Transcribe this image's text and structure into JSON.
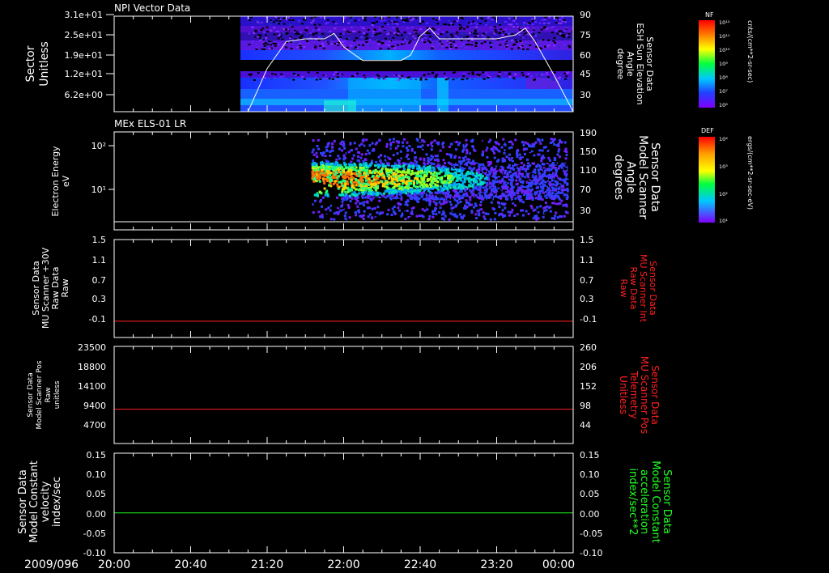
{
  "colors": {
    "background": "#000000",
    "axis": "#ffffff",
    "red": "#ff2020",
    "green": "#20ff20"
  },
  "x_axis": {
    "date_label": "2009/096",
    "tick_labels": [
      "20:00",
      "20:40",
      "21:20",
      "22:00",
      "22:40",
      "23:20",
      "00:00"
    ],
    "start": "20:00",
    "end": "00:00"
  },
  "panels": [
    {
      "id": "sector",
      "title": "NPI Vector Data",
      "left_label": [
        "Sector",
        "Unitless"
      ],
      "left_ticks": [
        "3.1e+01",
        "2.5e+01",
        "1.9e+01",
        "1.2e+01",
        "6.2e+00"
      ],
      "right_label": [
        "Sensor Data",
        "ESH Sun Elevation",
        "Angle",
        "degree"
      ],
      "right_ticks": [
        "90",
        "75",
        "60",
        "45",
        "30"
      ],
      "colorbar": {
        "title": "NF",
        "unit": "cnts/(cm**2-sr-sec)",
        "tick_labels": [
          "10¹²",
          "10¹¹",
          "10¹⁰",
          "10⁹",
          "10⁸",
          "10⁷",
          "10⁶"
        ]
      }
    },
    {
      "id": "els",
      "title": "MEx ELS-01 LR",
      "left_label": [
        "Electron Energy",
        "eV"
      ],
      "left_ticks": [
        "10²",
        "10¹"
      ],
      "right_label": [
        "Sensor Data",
        "Model Scanner",
        "Angle",
        "degrees"
      ],
      "right_ticks": [
        "190",
        "150",
        "110",
        "70",
        "30"
      ],
      "colorbar": {
        "title": "DEF",
        "unit": "ergs/(cm**2-sr-sec-eV)",
        "tick_labels": [
          "10⁴",
          "10³",
          "10²",
          "10¹"
        ]
      }
    },
    {
      "id": "mu30",
      "left_label": [
        "Sensor Data",
        "MU Scanner +30V",
        "Raw Data",
        "Raw"
      ],
      "left_ticks": [
        "1.5",
        "1.1",
        "0.7",
        "0.3",
        "-0.1"
      ],
      "right_label": [
        "Sensor Data",
        "MU Scanner Int",
        "Raw Data",
        "Raw"
      ],
      "right_ticks": [
        "1.5",
        "1.1",
        "0.7",
        "0.3",
        "-0.1"
      ]
    },
    {
      "id": "scanpos",
      "left_label": [
        "Sensor Data",
        "Model Scanner Pos",
        "Raw",
        "unitless"
      ],
      "left_ticks": [
        "23500",
        "18800",
        "14100",
        "9400",
        "4700"
      ],
      "right_label": [
        "Sensor Data",
        "MU Scanner Pos",
        "Telemetry",
        "Unitless"
      ],
      "right_ticks": [
        "260",
        "206",
        "152",
        "98",
        "44"
      ]
    },
    {
      "id": "constvel",
      "left_label": [
        "Sensor Data",
        "Model Constant",
        "velocity",
        "index/sec"
      ],
      "left_ticks": [
        "0.15",
        "0.10",
        "0.05",
        "0.00",
        "-0.05",
        "-0.10"
      ],
      "right_label": [
        "Sensor Data",
        "Model Constant",
        "acceleration",
        "index/sec**2"
      ],
      "right_ticks": [
        "0.15",
        "0.10",
        "0.05",
        "0.00",
        "-0.05",
        "-0.10"
      ]
    }
  ],
  "chart_data": [
    {
      "type": "heatmap",
      "title": "NPI Vector Data",
      "ylabel": "Sector Unitless",
      "y_ticks": [
        "3.1e+01",
        "2.5e+01",
        "1.9e+01",
        "1.2e+01",
        "6.2e+00"
      ],
      "data_start": "21:10",
      "overlay_series": {
        "name": "Sensor Data ESH Sun Elevation Angle",
        "unit": "degree",
        "y_range": [
          18,
          90
        ],
        "x": [
          "20:00",
          "20:30",
          "21:00",
          "21:10",
          "21:20",
          "21:30",
          "21:40",
          "21:45",
          "21:50",
          "21:55",
          "22:00",
          "22:10",
          "22:20",
          "22:30",
          "22:35",
          "22:40",
          "22:45",
          "22:50",
          "23:00",
          "23:20",
          "23:30",
          "23:35",
          "23:40",
          "23:50",
          "00:00"
        ],
        "y": [
          18,
          18,
          18,
          18,
          50,
          70,
          72,
          72,
          72,
          76,
          66,
          56,
          56,
          56,
          60,
          74,
          80,
          72,
          72,
          72,
          75,
          80,
          70,
          45,
          18
        ]
      }
    },
    {
      "type": "heatmap",
      "title": "MEx ELS-01 LR",
      "ylabel": "Electron Energy eV",
      "data_start": "21:43",
      "overlay_series": {
        "name": "Sensor Data Model Scanner Angle",
        "unit": "degrees",
        "y_range": [
          0,
          190
        ],
        "x": [
          "20:00",
          "00:00"
        ],
        "y": [
          0,
          0
        ]
      }
    },
    {
      "type": "line",
      "ylabel": "Sensor Data MU Scanner +30V Raw Data Raw",
      "ylim": [
        -0.3,
        1.5
      ],
      "x": [
        "20:00",
        "00:00"
      ],
      "series": [
        {
          "name": "Sensor Data MU Scanner Int Raw Data Raw",
          "color": "#ff2020",
          "values": [
            0.0,
            0.0
          ]
        }
      ]
    },
    {
      "type": "line",
      "ylabel": "Sensor Data Model Scanner Pos Raw unitless",
      "ylim": [
        0,
        23500
      ],
      "right_ylim": [
        0,
        260
      ],
      "x": [
        "20:00",
        "00:00"
      ],
      "series": [
        {
          "name": "Sensor Data MU Scanner Pos Telemetry Unitless",
          "color": "#ff2020",
          "values": [
            8300,
            8300
          ]
        }
      ]
    },
    {
      "type": "line",
      "ylabel": "Sensor Data Model Constant velocity index/sec",
      "ylim": [
        -0.1,
        0.15
      ],
      "x": [
        "20:00",
        "00:00"
      ],
      "series": [
        {
          "name": "Sensor Data Model Constant acceleration index/sec**2",
          "color": "#20ff20",
          "values": [
            0.0,
            0.0
          ]
        }
      ]
    }
  ]
}
